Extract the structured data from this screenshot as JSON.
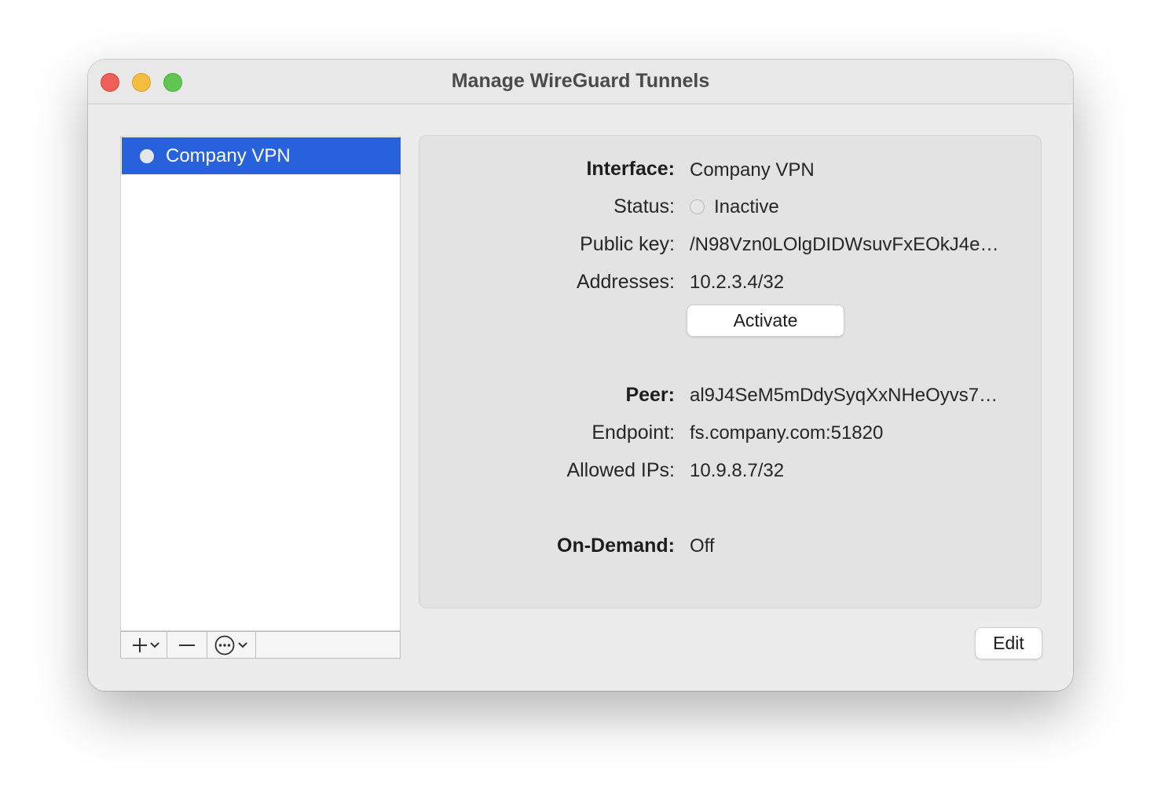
{
  "window": {
    "title": "Manage WireGuard Tunnels"
  },
  "tunnels": [
    {
      "name": "Company VPN",
      "selected": true,
      "status_icon": "status-dot-icon"
    }
  ],
  "list_toolbar": {
    "add_icon": "plus-icon",
    "add_menu_icon": "chevron-down-icon",
    "remove_icon": "minus-icon",
    "action_icon": "ellipsis-circle-icon",
    "action_menu_icon": "chevron-down-icon"
  },
  "interface": {
    "label": "Interface:",
    "value": "Company VPN",
    "status_label": "Status:",
    "status_value": "Inactive",
    "public_key_label": "Public key:",
    "public_key_value": "/N98Vzn0LOlgDIDWsuvFxEOkJ4e…",
    "addresses_label": "Addresses:",
    "addresses_value": "10.2.3.4/32",
    "activate_button": "Activate"
  },
  "peer": {
    "label": "Peer:",
    "value": "al9J4SeM5mDdySyqXxNHeOyvs7…",
    "endpoint_label": "Endpoint:",
    "endpoint_value": "fs.company.com:51820",
    "allowed_ips_label": "Allowed IPs:",
    "allowed_ips_value": "10.9.8.7/32"
  },
  "on_demand": {
    "label": "On-Demand:",
    "value": "Off"
  },
  "edit_button": "Edit",
  "colors": {
    "selection": "#2762dc",
    "close": "#ee5f57",
    "minimize": "#f4bd3f",
    "maximize": "#5fc651"
  }
}
